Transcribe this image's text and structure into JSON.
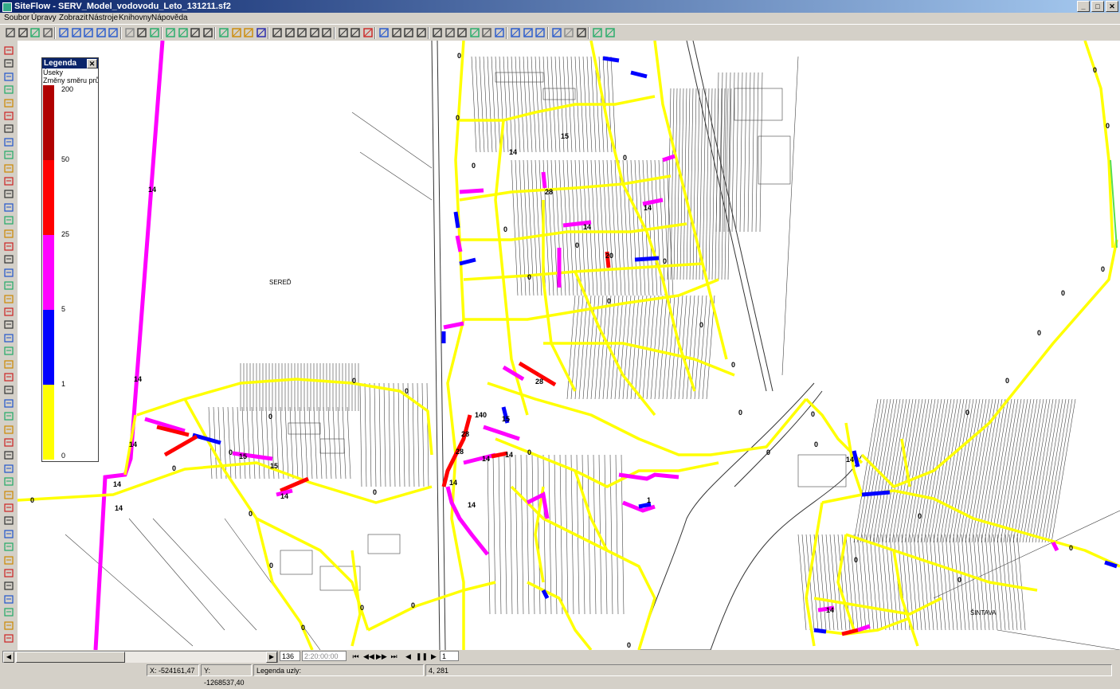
{
  "window": {
    "title": "SiteFlow - SERV_Model_vodovodu_Leto_131211.sf2",
    "min": "_",
    "max": "□",
    "close": "✕"
  },
  "menu": [
    {
      "label": "Soubor"
    },
    {
      "label": "Úpravy"
    },
    {
      "label": "Zobrazit"
    },
    {
      "label": "Nástroje"
    },
    {
      "label": "Knihovny"
    },
    {
      "label": "Nápověda"
    }
  ],
  "legend": {
    "title": "Legenda",
    "close": "✕",
    "layer": "Úseky",
    "quantity": "Změny směru průtoku",
    "ticks": [
      "200",
      "50",
      "25",
      "5",
      "1",
      "0"
    ],
    "colors": [
      "#b00000",
      "#ff0000",
      "#ff00ff",
      "#0000ff",
      "#ffff00"
    ]
  },
  "map": {
    "places": [
      "SEREĎ",
      "ŠINTAVA"
    ],
    "pipe_colors": {
      "main": "#ffff00",
      "high": "#ff00ff",
      "mid": "#0000ff",
      "red": "#ff0000",
      "dark": "#b00000"
    },
    "pipe_labels": [
      "14",
      "14",
      "14",
      "14",
      "14",
      "15",
      "15",
      "14",
      "140",
      "28",
      "28",
      "15",
      "14",
      "14",
      "14",
      "28",
      "14",
      "20",
      "14",
      "15",
      "14",
      "1",
      "14",
      "14",
      "14",
      "28"
    ],
    "node_labels": [
      "0",
      "0",
      "0",
      "0",
      "0",
      "0",
      "0",
      "0",
      "0",
      "0",
      "0",
      "0",
      "0",
      "0",
      "0",
      "0",
      "0",
      "0",
      "0",
      "0",
      "0",
      "0",
      "0",
      "0",
      "0",
      "0",
      "0",
      "0",
      "0",
      "0",
      "0",
      "0",
      "0",
      "0",
      "0",
      "0",
      "0",
      "0",
      "0",
      "0"
    ]
  },
  "playback": {
    "step": "136",
    "time": "2:20:00:00",
    "frame": "1",
    "first": "⏮",
    "prev": "◀◀",
    "next": "▶▶",
    "last": "⏭",
    "back": "◀",
    "pause": "❚❚",
    "play": "▶"
  },
  "status": {
    "x": "X: -524161,47",
    "y": "Y: -1268537,40",
    "legend_nodes": "Legenda uzly:",
    "pos": "4, 281"
  }
}
